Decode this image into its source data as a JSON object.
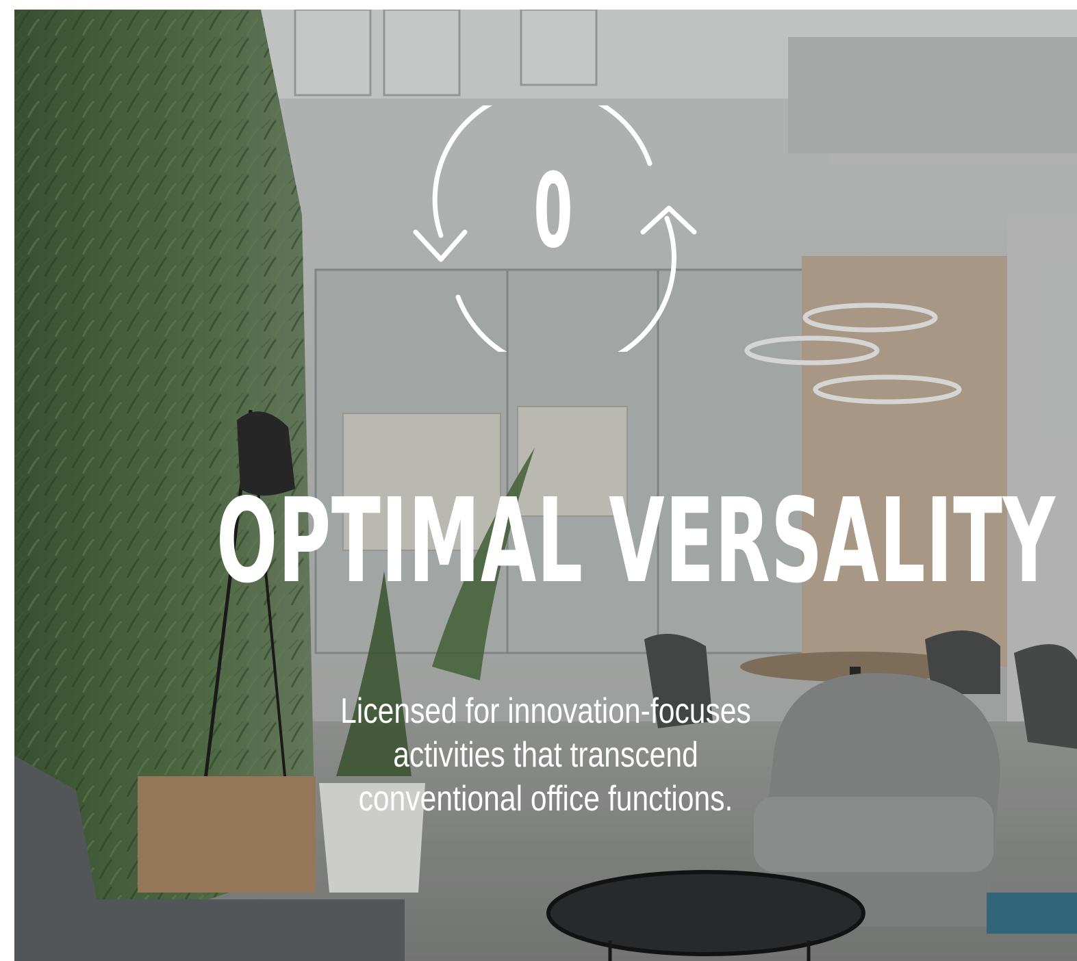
{
  "hero": {
    "icon_digit": "0",
    "title": "OPTIMAL VERSALITY",
    "description": "Licensed for innovation-focuses activities that transcend conventional office functions."
  },
  "icons": {
    "cycle": "refresh-cycle-icon"
  },
  "colors": {
    "text": "#ffffff",
    "overlay": "rgba(0,0,0,0.10)"
  }
}
